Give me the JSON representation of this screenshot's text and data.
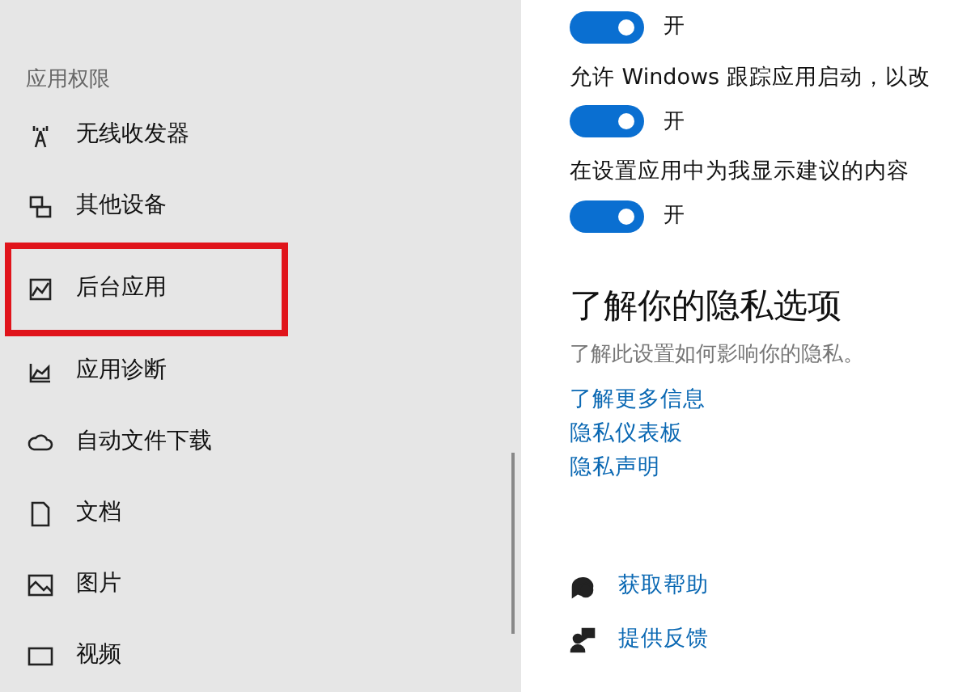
{
  "sidebar": {
    "section_title": "应用权限",
    "items": [
      {
        "label": "无线收发器",
        "highlighted": false
      },
      {
        "label": "其他设备",
        "highlighted": false
      },
      {
        "label": "后台应用",
        "highlighted": true
      },
      {
        "label": "应用诊断",
        "highlighted": false
      },
      {
        "label": "自动文件下载",
        "highlighted": false
      },
      {
        "label": "文档",
        "highlighted": false
      },
      {
        "label": "图片",
        "highlighted": false
      },
      {
        "label": "视频",
        "highlighted": false
      }
    ]
  },
  "settings": [
    {
      "toggle": {
        "on": true,
        "state_text": "开"
      }
    },
    {
      "label": "允许 Windows 跟踪应用启动，以改",
      "toggle": {
        "on": true,
        "state_text": "开"
      }
    },
    {
      "label": "在设置应用中为我显示建议的内容",
      "toggle": {
        "on": true,
        "state_text": "开"
      }
    }
  ],
  "privacy": {
    "heading": "了解你的隐私选项",
    "description": "了解此设置如何影响你的隐私。",
    "links": [
      "了解更多信息",
      "隐私仪表板",
      "隐私声明"
    ]
  },
  "help_links": [
    {
      "label": "获取帮助"
    },
    {
      "label": "提供反馈"
    }
  ]
}
